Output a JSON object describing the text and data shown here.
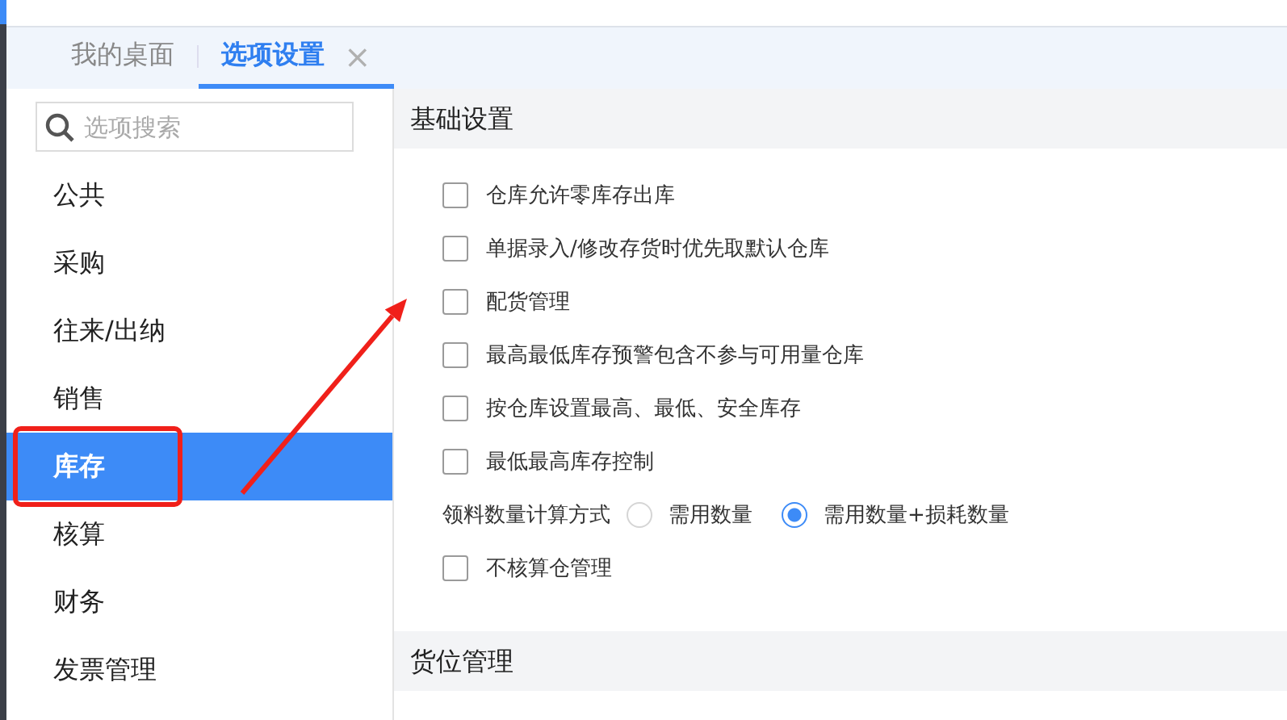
{
  "tabs": [
    {
      "label": "我的桌面",
      "selected": false
    },
    {
      "label": "选项设置",
      "selected": true,
      "close": "×"
    }
  ],
  "sidebar": {
    "search": {
      "placeholder": "选项搜索"
    },
    "items": [
      {
        "label": "公共",
        "selected": false,
        "annotated": false
      },
      {
        "label": "采购",
        "selected": false,
        "annotated": false
      },
      {
        "label": "往来/出纳",
        "selected": false,
        "annotated": false
      },
      {
        "label": "销售",
        "selected": false,
        "annotated": false
      },
      {
        "label": "库存",
        "selected": true,
        "annotated": true
      },
      {
        "label": "核算",
        "selected": false,
        "annotated": false
      },
      {
        "label": "财务",
        "selected": false,
        "annotated": false
      },
      {
        "label": "发票管理",
        "selected": false,
        "annotated": false
      }
    ]
  },
  "sections": [
    {
      "title": "基础设置",
      "options": [
        {
          "kind": "checkbox",
          "label": "仓库允许零库存出库",
          "checked": false
        },
        {
          "kind": "checkbox",
          "label": "单据录入/修改存货时优先取默认仓库",
          "checked": false
        },
        {
          "kind": "checkbox",
          "label": "配货管理",
          "checked": false,
          "annotated": true
        },
        {
          "kind": "checkbox",
          "label": "最高最低库存预警包含不参与可用量仓库",
          "checked": false
        },
        {
          "kind": "checkbox",
          "label": "按仓库设置最高、最低、安全库存",
          "checked": false
        },
        {
          "kind": "checkbox",
          "label": "最低最高库存控制",
          "checked": false
        },
        {
          "kind": "radio-group",
          "label": "领料数量计算方式",
          "choices": [
            {
              "label": "需用数量",
              "selected": false
            },
            {
              "label": "需用数量+损耗数量",
              "selected": true
            }
          ]
        },
        {
          "kind": "checkbox",
          "label": "不核算仓管理",
          "checked": false
        }
      ]
    },
    {
      "title": "货位管理"
    }
  ]
}
